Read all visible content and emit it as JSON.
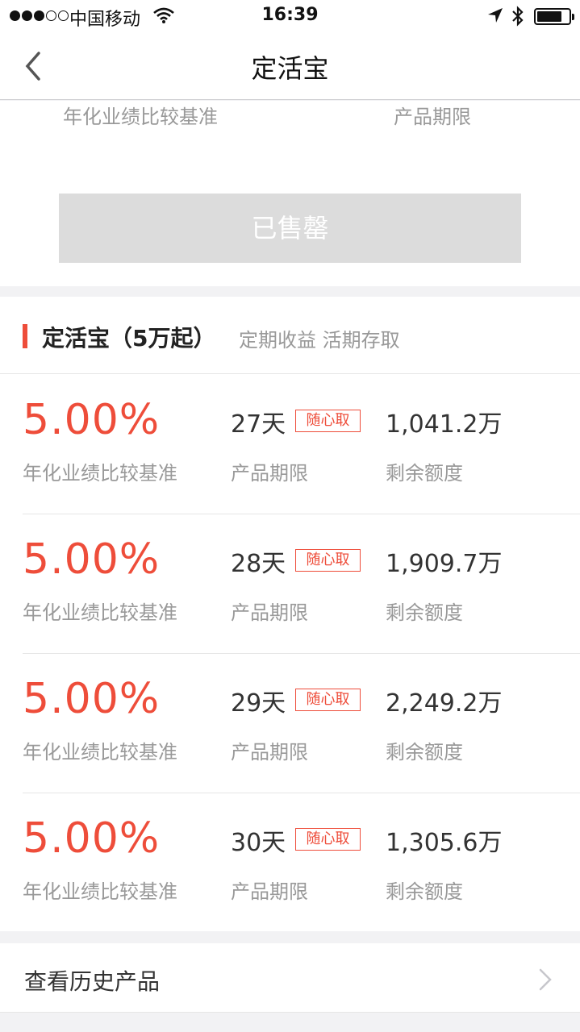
{
  "status_bar": {
    "carrier": "中国移动",
    "time": "16:39"
  },
  "nav": {
    "title": "定活宝"
  },
  "top_card": {
    "rate_label": "年化业绩比较基准",
    "term_label": "产品期限",
    "button_label": "已售罄"
  },
  "section": {
    "title": "定活宝（5万起）",
    "subtitle": "定期收益 活期存取"
  },
  "products": [
    {
      "rate": "5.00%",
      "rate_label": "年化业绩比较基准",
      "term": "27天",
      "tag": "随心取",
      "term_label": "产品期限",
      "remaining": "1,041.2万",
      "remaining_label": "剩余额度"
    },
    {
      "rate": "5.00%",
      "rate_label": "年化业绩比较基准",
      "term": "28天",
      "tag": "随心取",
      "term_label": "产品期限",
      "remaining": "1,909.7万",
      "remaining_label": "剩余额度"
    },
    {
      "rate": "5.00%",
      "rate_label": "年化业绩比较基准",
      "term": "29天",
      "tag": "随心取",
      "term_label": "产品期限",
      "remaining": "2,249.2万",
      "remaining_label": "剩余额度"
    },
    {
      "rate": "5.00%",
      "rate_label": "年化业绩比较基准",
      "term": "30天",
      "tag": "随心取",
      "term_label": "产品期限",
      "remaining": "1,305.6万",
      "remaining_label": "剩余额度"
    }
  ],
  "history": {
    "label": "查看历史产品"
  },
  "colors": {
    "accent": "#ee4d3a",
    "muted_text": "#999999",
    "soldout_bg": "#dcdcdc"
  },
  "icons": [
    "signal-dots-icon",
    "wifi-icon",
    "location-arrow-icon",
    "bluetooth-icon",
    "battery-icon",
    "back-chevron-icon",
    "chevron-right-icon"
  ]
}
